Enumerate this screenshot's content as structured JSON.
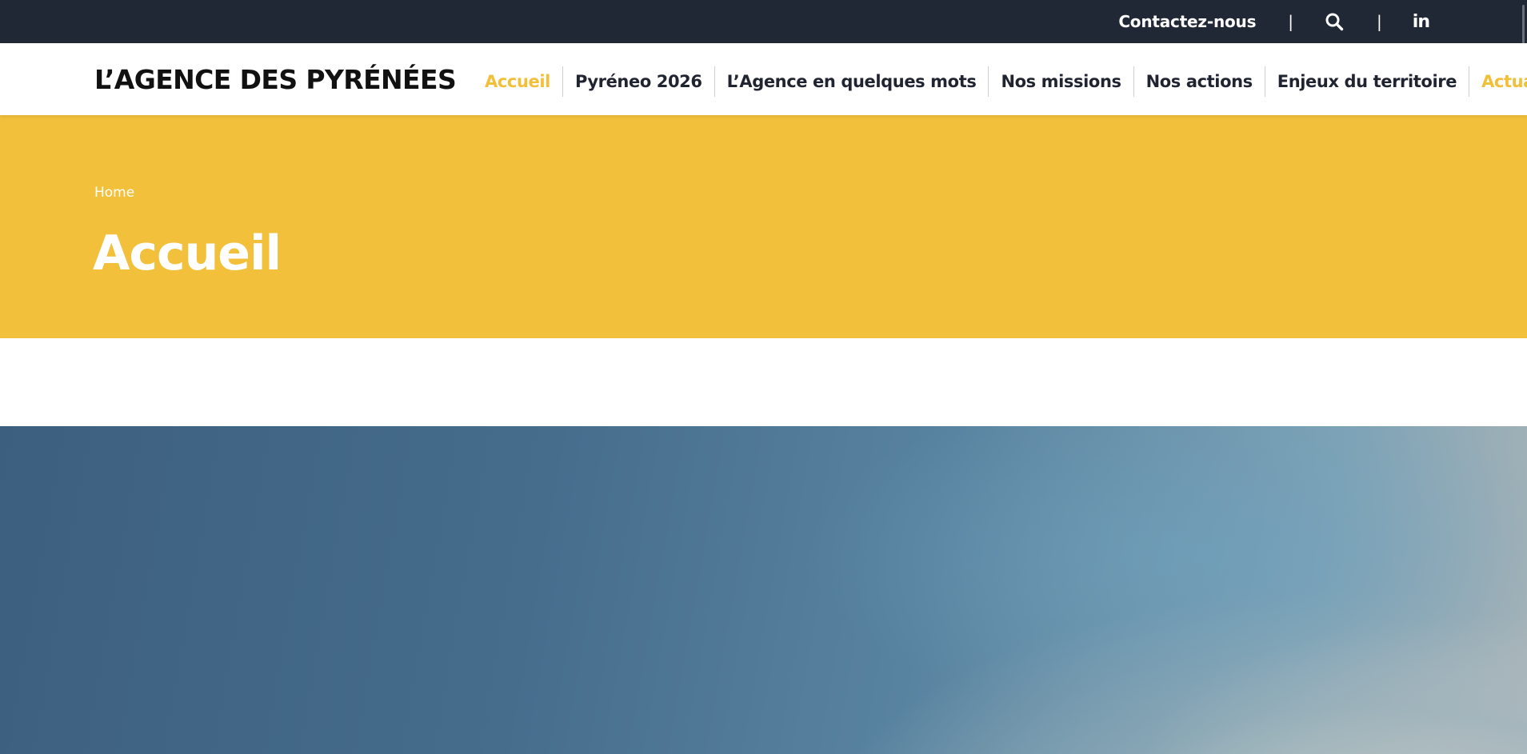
{
  "topbar": {
    "contact_label": "Contactez-nous",
    "separator": "|",
    "search_icon": "search-icon",
    "linkedin_label": "in"
  },
  "header": {
    "logo_text": "L’AGENCE DES PYRÉNÉES",
    "nav": [
      {
        "label": "Accueil",
        "active": true
      },
      {
        "label": "Pyréneo 2026",
        "active": false
      },
      {
        "label": "L’Agence en quelques mots",
        "active": false
      },
      {
        "label": "Nos missions",
        "active": false
      },
      {
        "label": "Nos actions",
        "active": false
      },
      {
        "label": "Enjeux du territoire",
        "active": false
      },
      {
        "label": "Actualités",
        "active": true
      }
    ]
  },
  "banner": {
    "breadcrumb": "Home",
    "title": "Accueil"
  },
  "colors": {
    "topbar_bg": "#212835",
    "accent_yellow": "#f2c03a",
    "nav_text": "#1f2430"
  }
}
